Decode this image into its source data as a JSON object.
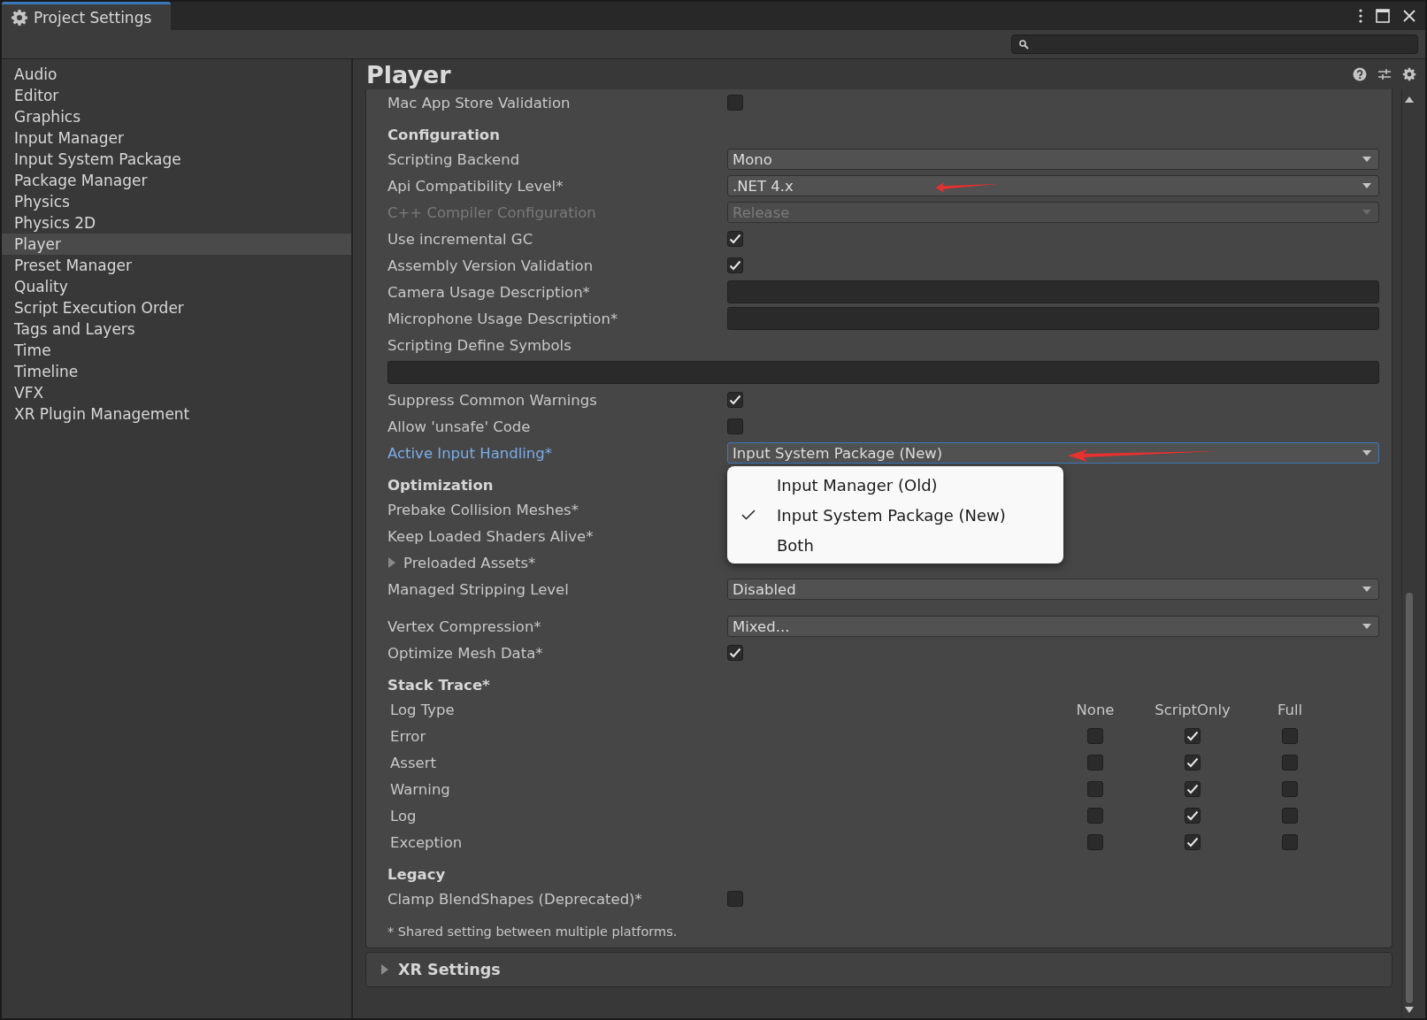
{
  "window": {
    "tab": "Project Settings"
  },
  "sidebar": {
    "items": [
      {
        "label": "Audio",
        "selected": false
      },
      {
        "label": "Editor",
        "selected": false
      },
      {
        "label": "Graphics",
        "selected": false
      },
      {
        "label": "Input Manager",
        "selected": false
      },
      {
        "label": "Input System Package",
        "selected": false
      },
      {
        "label": "Package Manager",
        "selected": false
      },
      {
        "label": "Physics",
        "selected": false
      },
      {
        "label": "Physics 2D",
        "selected": false
      },
      {
        "label": "Player",
        "selected": true
      },
      {
        "label": "Preset Manager",
        "selected": false
      },
      {
        "label": "Quality",
        "selected": false
      },
      {
        "label": "Script Execution Order",
        "selected": false
      },
      {
        "label": "Tags and Layers",
        "selected": false
      },
      {
        "label": "Time",
        "selected": false
      },
      {
        "label": "Timeline",
        "selected": false
      },
      {
        "label": "VFX",
        "selected": false
      },
      {
        "label": "XR Plugin Management",
        "selected": false
      }
    ]
  },
  "inspector": {
    "title": "Player",
    "rows": [
      {
        "kind": "checkbox",
        "label": "Mac App Store Validation",
        "checked": false
      },
      {
        "kind": "header",
        "label": "Configuration"
      },
      {
        "kind": "dropdown",
        "label": "Scripting Backend",
        "value": "Mono",
        "disabled": false,
        "focused": false
      },
      {
        "kind": "dropdown",
        "label": "Api Compatibility Level*",
        "value": ".NET 4.x",
        "disabled": false,
        "focused": false,
        "annotated": true
      },
      {
        "kind": "dropdown",
        "label": "C++ Compiler Configuration",
        "value": "Release",
        "disabled": true,
        "focused": false
      },
      {
        "kind": "checkbox",
        "label": "Use incremental GC",
        "checked": true
      },
      {
        "kind": "checkbox",
        "label": "Assembly Version Validation",
        "checked": true
      },
      {
        "kind": "textfield",
        "label": "Camera Usage Description*"
      },
      {
        "kind": "textfield",
        "label": "Microphone Usage Description*"
      },
      {
        "kind": "widefield",
        "label": "Scripting Define Symbols"
      },
      {
        "kind": "checkbox",
        "label": "Suppress Common Warnings",
        "checked": true
      },
      {
        "kind": "checkbox",
        "label": "Allow 'unsafe' Code",
        "checked": false
      },
      {
        "kind": "dropdown",
        "label": "Active Input Handling*",
        "value": "Input System Package (New)",
        "disabled": false,
        "focused": true,
        "annotated": true,
        "popup": [
          {
            "label": "Input Manager (Old)",
            "selected": false
          },
          {
            "label": "Input System Package (New)",
            "selected": true
          },
          {
            "label": "Both",
            "selected": false
          }
        ]
      },
      {
        "kind": "header",
        "label": "Optimization"
      },
      {
        "kind": "label",
        "label": "Prebake Collision Meshes*"
      },
      {
        "kind": "label",
        "label": "Keep Loaded Shaders Alive*"
      },
      {
        "kind": "foldout",
        "label": "Preloaded Assets*",
        "expanded": false
      },
      {
        "kind": "dropdown",
        "label": "Managed Stripping Level",
        "value": "Disabled",
        "disabled": false,
        "focused": false
      },
      {
        "kind": "dropdown",
        "label": "Vertex Compression*",
        "value": "Mixed...",
        "disabled": false,
        "focused": false,
        "spaced": true
      },
      {
        "kind": "checkbox",
        "label": "Optimize Mesh Data*",
        "checked": true
      },
      {
        "kind": "header",
        "label": "Stack Trace*"
      },
      {
        "kind": "stacktrace",
        "columns": [
          "Log Type",
          "None",
          "ScriptOnly",
          "Full"
        ],
        "rows": [
          {
            "type": "Error",
            "checks": [
              false,
              true,
              false
            ]
          },
          {
            "type": "Assert",
            "checks": [
              false,
              true,
              false
            ]
          },
          {
            "type": "Warning",
            "checks": [
              false,
              true,
              false
            ]
          },
          {
            "type": "Log",
            "checks": [
              false,
              true,
              false
            ]
          },
          {
            "type": "Exception",
            "checks": [
              false,
              true,
              false
            ]
          }
        ]
      },
      {
        "kind": "header",
        "label": "Legacy"
      },
      {
        "kind": "checkbox",
        "label": "Clamp BlendShapes (Deprecated)*",
        "checked": false
      },
      {
        "kind": "note",
        "label": "* Shared setting between multiple platforms."
      }
    ],
    "xr_settings": {
      "label": "XR Settings",
      "expanded": false
    }
  }
}
